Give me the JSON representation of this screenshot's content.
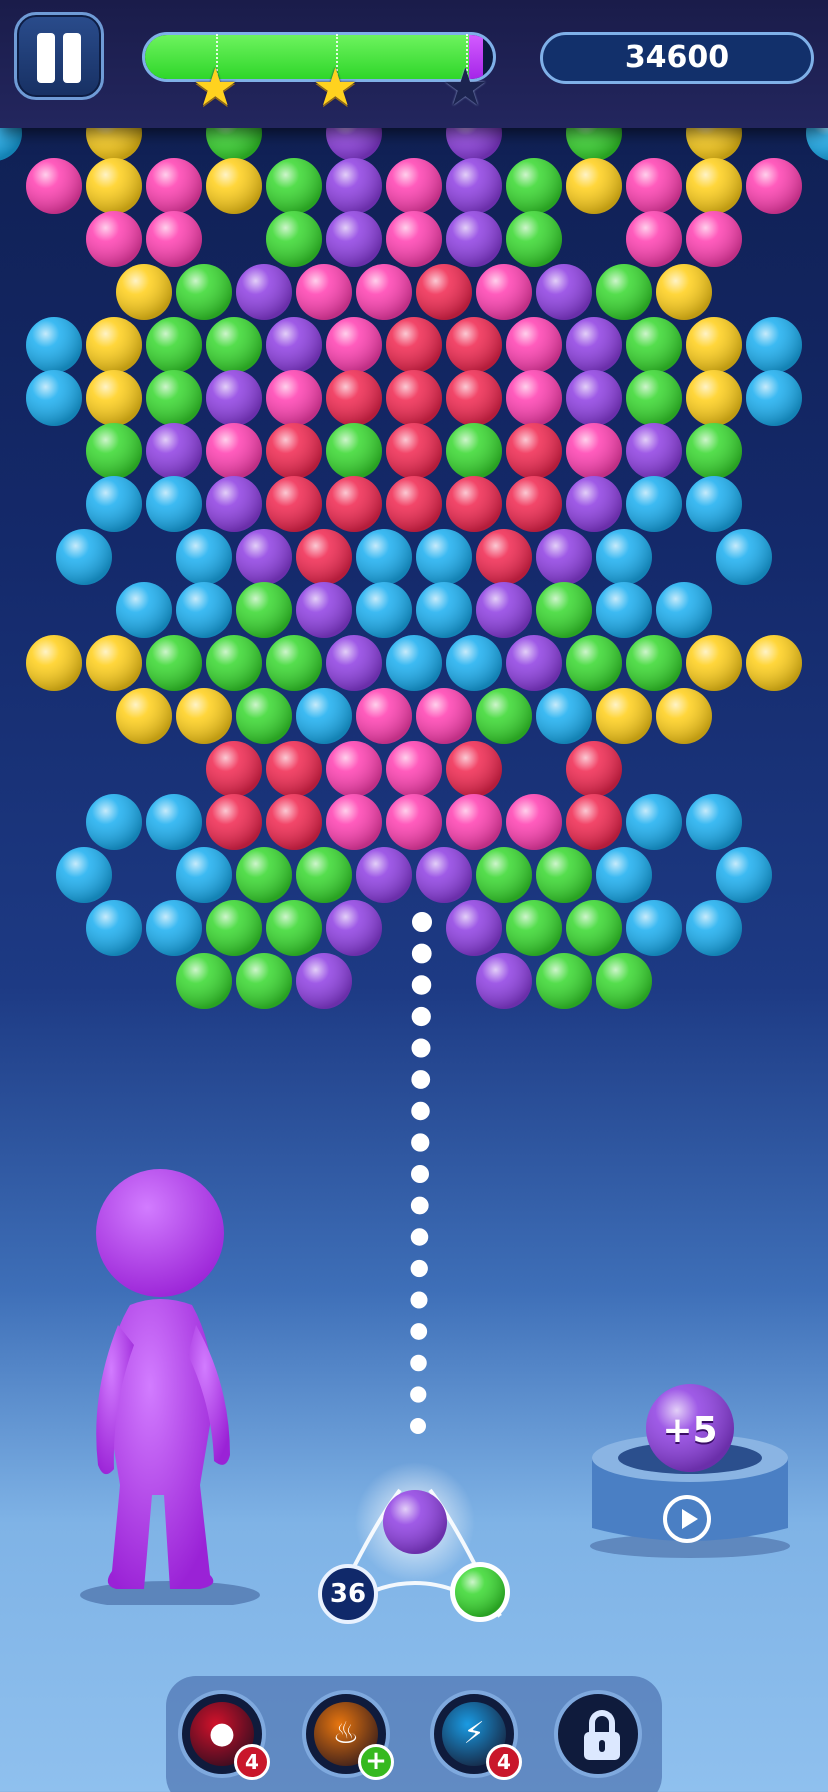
{
  "hud": {
    "score": "34600",
    "progress": 0.93,
    "progress_reserve": 0.04,
    "stars": [
      "earned",
      "earned",
      "empty"
    ]
  },
  "colors": {
    "pink": "#ff3fb1",
    "yellow": "#ffcf19",
    "green": "#37d82e",
    "purple": "#8e3ee2",
    "red": "#f0264f",
    "blue": "#1aaef0",
    "score_box_bg": "#12306b",
    "progress_fill": "#2fd62a"
  },
  "board": {
    "rows": [
      "p.p.b.y.g.v.v.g.y.b.p.p",
      "pypygvpvgypyp",
      "pp.gvpvg.pp",
      "ygvpprpvgy",
      "byggvprrpvgyb",
      "bygvprrrpvgyb",
      "gvprgrgrpvg",
      "bbvrrrrrvbb",
      "b.bvrbbrvb.b",
      "bbgvbbvgbb",
      "yygggvbbvggyy",
      "yygbppgbyy",
      "rrppr.r",
      "bbrrpppprbb",
      "b.bggvvggb.b",
      "bbggv.vggbb",
      "ggv..vgg"
    ],
    "legend": "p=pink y=yellow g=green v=purple r=red b=blue .=empty"
  },
  "shooter": {
    "current_ball": "purple",
    "next_ball": "green",
    "shots_left": "36"
  },
  "bonus": {
    "label": "+5",
    "ball": "purple",
    "action": "play-video-icon"
  },
  "boosters": [
    {
      "name": "bomb",
      "icon": "bomb-icon",
      "count": "4",
      "color": "#d2122b"
    },
    {
      "name": "fireball",
      "icon": "fire-icon",
      "count": "+",
      "color": "#e8760f"
    },
    {
      "name": "lightning",
      "icon": "lightning-icon",
      "count": "4",
      "color": "#1a9be3"
    },
    {
      "name": "locked",
      "icon": "lock-icon",
      "count": "",
      "color": "#1a2f63"
    }
  ]
}
